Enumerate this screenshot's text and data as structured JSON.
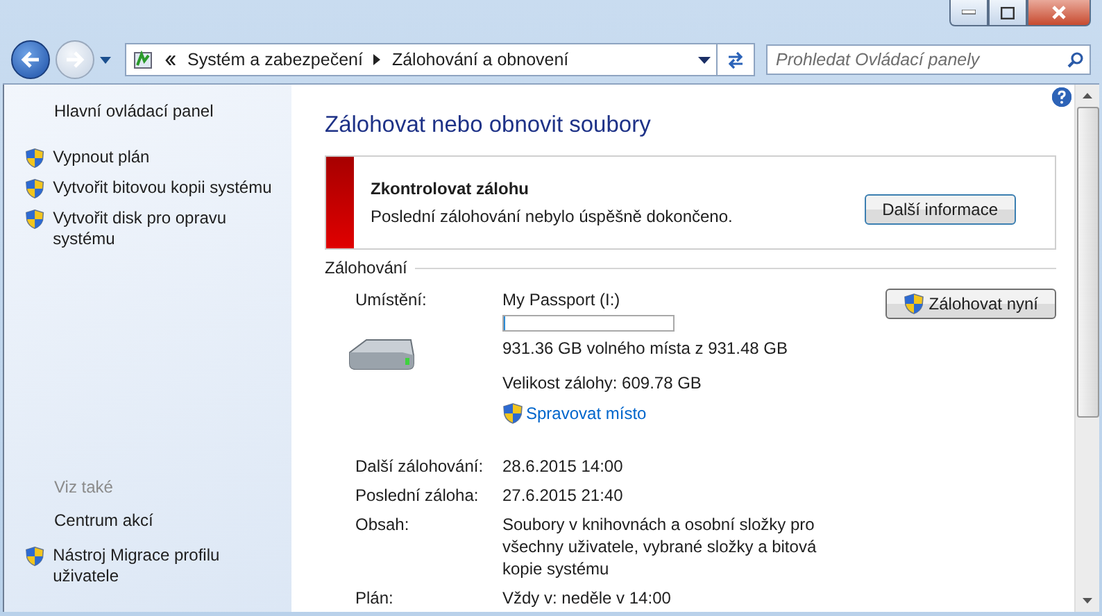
{
  "nav": {
    "breadcrumb": [
      "Systém a zabezpečení",
      "Zálohování a obnovení"
    ],
    "search": {
      "placeholder": "Prohledat Ovládací panely"
    }
  },
  "sidebar": {
    "home": "Hlavní ovládací panel",
    "tasks": [
      {
        "label": "Vypnout plán",
        "shield": true
      },
      {
        "label": "Vytvořit bitovou kopii systému",
        "shield": true
      },
      {
        "label": "Vytvořit disk pro opravu systému",
        "shield": true
      }
    ],
    "see_also_title": "Viz také",
    "see_also": [
      {
        "label": "Centrum akcí",
        "shield": false
      },
      {
        "label": "Nástroj Migrace profilu uživatele",
        "shield": true
      }
    ]
  },
  "main": {
    "title": "Zálohovat nebo obnovit soubory",
    "alert": {
      "title": "Zkontrolovat zálohu",
      "message": "Poslední zálohování nebylo úspěšně dokončeno.",
      "button": "Další informace"
    },
    "section_title": "Zálohování",
    "location_label": "Umístění:",
    "location": "My Passport (I:)",
    "usage": {
      "level": 0.01
    },
    "free_space": "931.36 GB volného místa z 931.48 GB",
    "backup_size": "Velikost zálohy: 609.78 GB",
    "manage_link": "Spravovat místo",
    "backup_button": "Zálohovat nyní",
    "details": [
      {
        "label": "Další zálohování:",
        "value": "28.6.2015 14:00"
      },
      {
        "label": "Poslední záloha:",
        "value": "27.6.2015 21:40"
      },
      {
        "label": "Obsah:",
        "value": "Soubory v knihovnách a osobní složky pro všechny uživatele, vybrané složky a bitová kopie systému"
      },
      {
        "label": "Plán:",
        "value": "Vždy v: neděle v 14:00"
      }
    ]
  }
}
